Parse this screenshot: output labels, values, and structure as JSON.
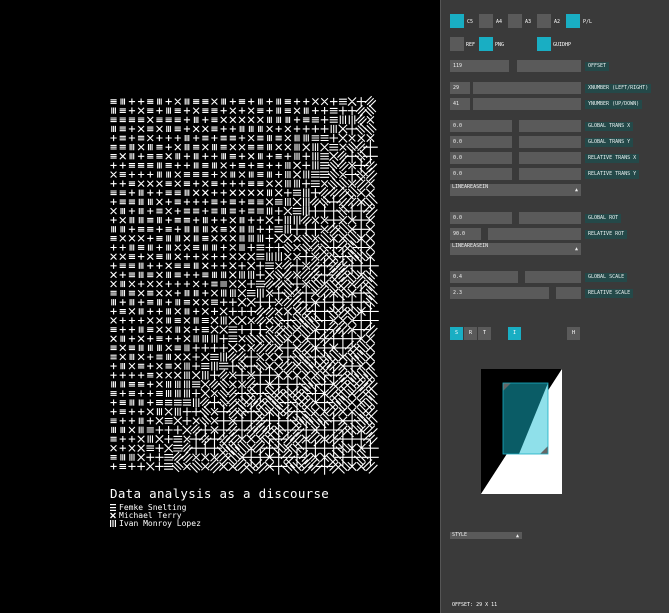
{
  "poster": {
    "title": "Data analysis as a discourse",
    "authors": [
      {
        "symbol": "triple-bar",
        "name": "Femke Snelting"
      },
      {
        "symbol": "cross",
        "name": "Michael Terry"
      },
      {
        "symbol": "vertical-bars",
        "name": "Ivan Monroy Lopez"
      }
    ]
  },
  "panel": {
    "formats": [
      {
        "label": "C5",
        "checked": true
      },
      {
        "label": "A4",
        "checked": false
      },
      {
        "label": "A3",
        "checked": false
      },
      {
        "label": "A2",
        "checked": false
      },
      {
        "label": "P/L",
        "checked": true
      }
    ],
    "options": [
      {
        "label": "REF",
        "checked": false
      },
      {
        "label": "PNG",
        "checked": true
      },
      {
        "label": "GUIDHP",
        "checked": true
      }
    ],
    "offset": {
      "value": "119",
      "label": "OFFSET"
    },
    "x_number": {
      "value": "29",
      "label": "XNUMBER  (LEFT/RIGHT)"
    },
    "y_number": {
      "value": "41",
      "label": "YNUMBER  (UP/DOWN)"
    },
    "global_trans_x": {
      "value": "0.0",
      "label": "GLOBAL TRANS X"
    },
    "global_trans_y": {
      "value": "0.0",
      "label": "GLOBAL TRANS Y"
    },
    "relative_trans_x": {
      "value": "0.0",
      "label": "RELATIVE TRANS X"
    },
    "relative_trans_y": {
      "value": "0.0",
      "label": "RELATIVE TRANS Y"
    },
    "trans_easing": "LINEAREASEIN",
    "global_rot": {
      "value": "0.0",
      "label": "GLOBAL ROT"
    },
    "relative_rot": {
      "value": "90.0",
      "label": "RELATIVE ROT"
    },
    "rot_easing": "LINEAREASEIN",
    "global_scale": {
      "value": "0.4",
      "label": "GLOBAL SCALE"
    },
    "relative_scale": {
      "value": "2.3",
      "label": "RELATIVE SCALE"
    },
    "mode_buttons": [
      {
        "label": "S",
        "active": true
      },
      {
        "label": "R",
        "active": false
      },
      {
        "label": "T",
        "active": false
      },
      {
        "label": "I",
        "active": true
      },
      {
        "label": "H",
        "active": false
      }
    ],
    "style_dropdown": "STYLE",
    "status": "OFFSET: 29 X 11"
  },
  "colors": {
    "accent": "#19aec3",
    "panel": "#3a3a3a",
    "field": "#5a5a5a",
    "label_bg": "#244949"
  }
}
